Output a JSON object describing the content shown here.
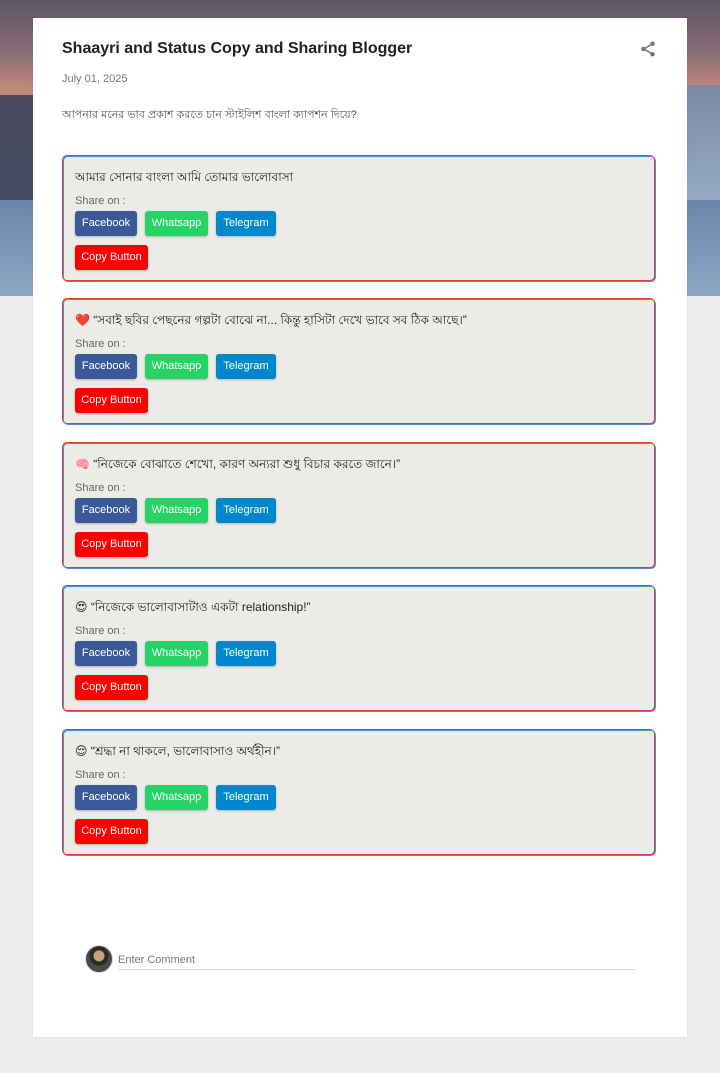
{
  "post": {
    "title": "Shaayri and Status Copy and Sharing Blogger",
    "date": "July 01, 2025",
    "intro": "আপনার মনের ভাব প্রকাশ করতে চান স্টাইলিশ বাংলা ক্যাপশন দিয়ে?"
  },
  "quotes": [
    {
      "text": "আমার সোনার বাংলা আমি তোমার ভালোবাসা",
      "share_label": "Share on :",
      "facebook": "Facebook",
      "whatsapp": "Whatsapp",
      "telegram": "Telegram",
      "copy": "Copy Button"
    },
    {
      "text": "❤️ “সবাই ছবির পেছনের গল্পটা বোঝে না... কিন্তু হাসিটা দেখে ভাবে সব ঠিক আছে।”",
      "share_label": "Share on :",
      "facebook": "Facebook",
      "whatsapp": "Whatsapp",
      "telegram": "Telegram",
      "copy": "Copy Button"
    },
    {
      "text": "🧠 “নিজেকে বোঝাতে শেখো, কারণ অন্যরা শুধু বিচার করতে জানে।”",
      "share_label": "Share on :",
      "facebook": "Facebook",
      "whatsapp": "Whatsapp",
      "telegram": "Telegram",
      "copy": "Copy Button"
    },
    {
      "text": "😍 “নিজেকে ভালোবাসাটাও একটা relationship!”",
      "share_label": "Share on :",
      "facebook": "Facebook",
      "whatsapp": "Whatsapp",
      "telegram": "Telegram",
      "copy": "Copy Button"
    },
    {
      "text": "😌 “শ্রদ্ধা না থাকলে, ভালোবাসাও অর্থহীন।”",
      "share_label": "Share on :",
      "facebook": "Facebook",
      "whatsapp": "Whatsapp",
      "telegram": "Telegram",
      "copy": "Copy Button"
    }
  ],
  "comment": {
    "placeholder": "Enter Comment"
  },
  "icons": {
    "share": "share-icon",
    "avatar": "user-avatar"
  },
  "colors": {
    "facebook": "#3b5998",
    "whatsapp": "#25d366",
    "telegram": "#0088cc",
    "copy": "#ff0000"
  }
}
